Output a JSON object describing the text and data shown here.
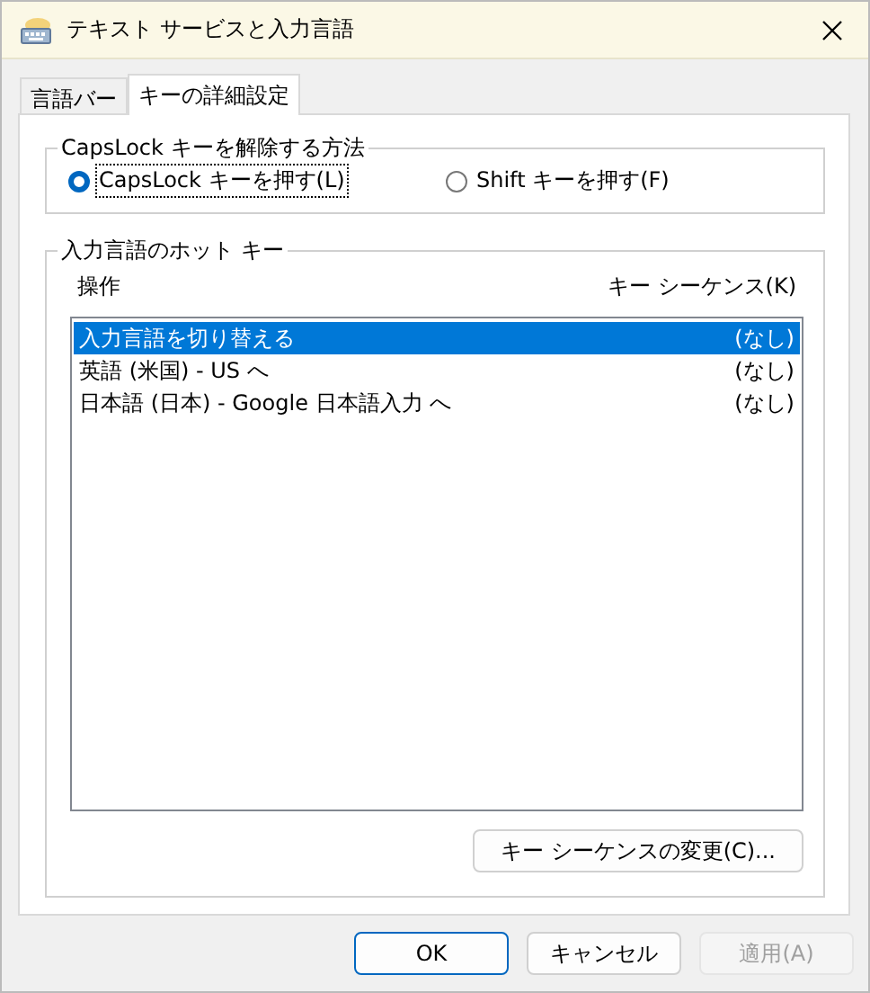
{
  "window": {
    "title": "テキスト サービスと入力言語"
  },
  "tabs": [
    {
      "label": "言語バー",
      "selected": false
    },
    {
      "label": "キーの詳細設定",
      "selected": true
    }
  ],
  "capslock_group": {
    "title": "CapsLock キーを解除する方法",
    "options": [
      {
        "label": "CapsLock キーを押す(L)",
        "selected": true,
        "focused": true
      },
      {
        "label": "Shift キーを押す(F)",
        "selected": false,
        "focused": false
      }
    ]
  },
  "hotkeys_group": {
    "title": "入力言語のホット キー",
    "columns": [
      "操作",
      "キー シーケンス(K)"
    ],
    "rows": [
      {
        "action": "入力言語を切り替える",
        "sequence": "(なし)",
        "selected": true
      },
      {
        "action": "英語 (米国) - US へ",
        "sequence": "(なし)",
        "selected": false
      },
      {
        "action": "日本語 (日本) - Google 日本語入力 へ",
        "sequence": "(なし)",
        "selected": false
      }
    ],
    "change_button": "キー シーケンスの変更(C)..."
  },
  "buttons": [
    {
      "label": "OK",
      "default": true,
      "disabled": false
    },
    {
      "label": "キャンセル",
      "default": false,
      "disabled": false
    },
    {
      "label": "適用(A)",
      "default": false,
      "disabled": true
    }
  ]
}
